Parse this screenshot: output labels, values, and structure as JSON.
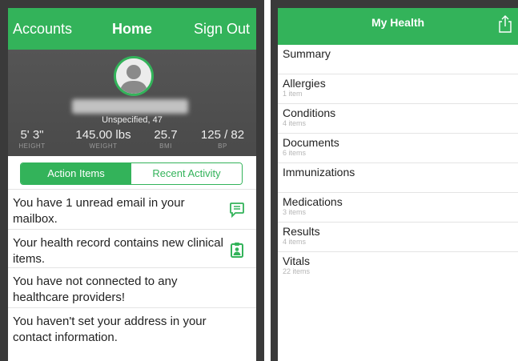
{
  "left": {
    "nav": {
      "left_label": "Accounts",
      "title": "Home",
      "right_label": "Sign Out"
    },
    "profile": {
      "avatar_icon": "person-silhouette-icon",
      "subtitle": "Unspecified, 47",
      "stats": [
        {
          "value": "5' 3\"",
          "label": "HEIGHT"
        },
        {
          "value": "145.00 lbs",
          "label": "WEIGHT"
        },
        {
          "value": "25.7",
          "label": "BMI"
        },
        {
          "value": "125 / 82",
          "label": "BP"
        }
      ]
    },
    "tabs": [
      {
        "label": "Action Items",
        "selected": true
      },
      {
        "label": "Recent Activity",
        "selected": false
      }
    ],
    "items": [
      {
        "text": "You have 1 unread email in your mailbox.",
        "icon": "message-icon"
      },
      {
        "text": "Your health record contains new clinical items.",
        "icon": "clipboard-person-icon"
      },
      {
        "text": "You have not connected to any healthcare providers!",
        "icon": ""
      },
      {
        "text": "You haven't set your address in your contact information.",
        "icon": ""
      }
    ]
  },
  "right": {
    "nav": {
      "title": "My Health",
      "share_icon": "share-icon"
    },
    "items": [
      {
        "title": "Summary",
        "subtitle": ""
      },
      {
        "title": "Allergies",
        "subtitle": "1 item"
      },
      {
        "title": "Conditions",
        "subtitle": "4 items"
      },
      {
        "title": "Documents",
        "subtitle": "6 items"
      },
      {
        "title": "Immunizations",
        "subtitle": ""
      },
      {
        "title": "Medications",
        "subtitle": "3 items"
      },
      {
        "title": "Results",
        "subtitle": "4 items"
      },
      {
        "title": "Vitals",
        "subtitle": "22 items"
      }
    ]
  },
  "colors": {
    "accent": "#33b35a",
    "header_dark": "#4e4e4e"
  }
}
